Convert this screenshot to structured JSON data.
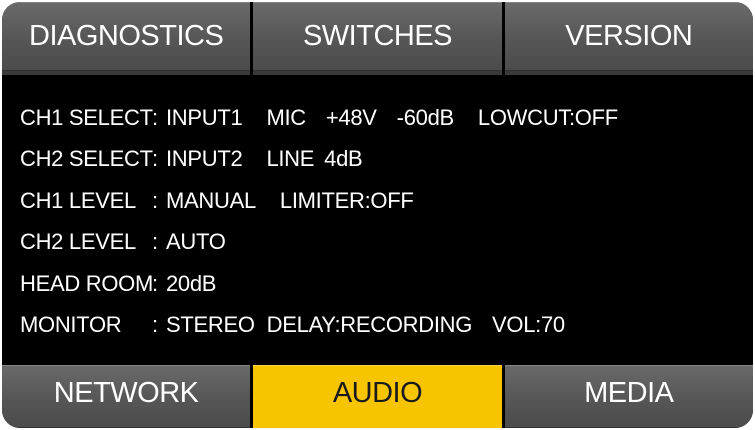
{
  "top_tabs": [
    {
      "label": "DIAGNOSTICS"
    },
    {
      "label": "SWITCHES"
    },
    {
      "label": "VERSION"
    }
  ],
  "rows": [
    {
      "label": "CH1 SELECT",
      "colon": ":",
      "values": [
        "INPUT1",
        "MIC",
        "+48V",
        "-60dB",
        "LOWCUT:OFF"
      ]
    },
    {
      "label": "CH2 SELECT",
      "colon": ":",
      "values": [
        "INPUT2",
        "LINE",
        "4dB"
      ]
    },
    {
      "label": "CH1 LEVEL",
      "colon": ":",
      "values": [
        "MANUAL",
        "LIMITER:OFF"
      ]
    },
    {
      "label": "CH2 LEVEL",
      "colon": ":",
      "values": [
        "AUTO"
      ]
    },
    {
      "label": "HEAD ROOM",
      "colon": ":",
      "values": [
        "20dB"
      ]
    },
    {
      "label": "MONITOR",
      "colon": ":",
      "values": [
        "STEREO",
        "DELAY:RECORDING",
        "VOL:70"
      ]
    }
  ],
  "bottom_tabs": [
    {
      "label": "NETWORK"
    },
    {
      "label": "AUDIO",
      "active": true
    },
    {
      "label": "MEDIA"
    }
  ],
  "colors": {
    "active_tab": "#f6c500",
    "tab": "#565656",
    "background": "#000000",
    "text": "#ffffff"
  }
}
